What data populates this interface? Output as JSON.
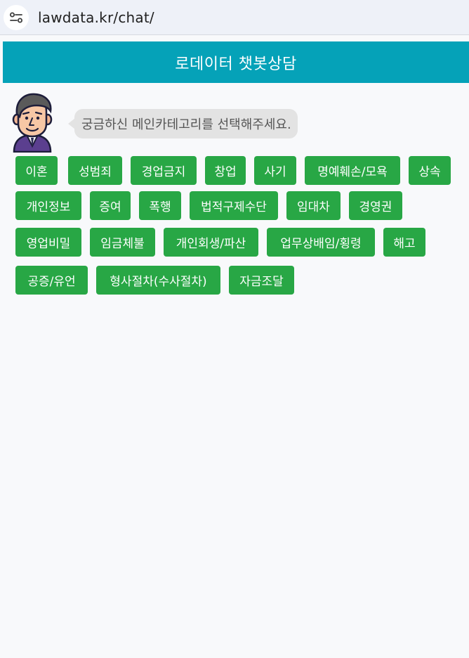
{
  "browser": {
    "url": "lawdata.kr/chat/",
    "site_info_icon": "tune-icon"
  },
  "header": {
    "title": "로데이터 챗봇상담",
    "color": "#05a2b8"
  },
  "chat": {
    "bot_avatar": "bot-avatar",
    "message": "궁금하신 메인카테고리를 선택해주세요."
  },
  "categories": [
    "이혼",
    "성범죄",
    "경업금지",
    "창업",
    "사기",
    "명예훼손/모욕",
    "상속",
    "개인정보",
    "증여",
    "폭행",
    "법적구제수단",
    "임대차",
    "경영권",
    "영업비밀",
    "임금체불",
    "개인회생/파산",
    "업무상배임/횡령",
    "해고",
    "공증/유언",
    "형사절차(수사절차)",
    "자금조달"
  ],
  "colors": {
    "button": "#28a745",
    "bubble": "#e3e3e3"
  }
}
